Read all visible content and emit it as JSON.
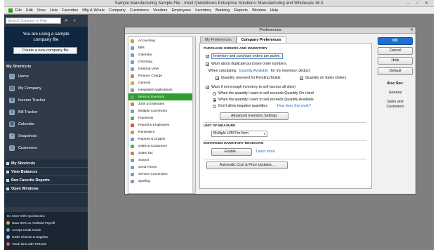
{
  "window": {
    "title": "Sample Manufacturing Sample File - Intuit QuickBooks Enterprise Solutions: Manufacturing and Wholesale 16.0",
    "controls": "– ▫ ✕"
  },
  "menu": [
    "File",
    "Edit",
    "View",
    "Lists",
    "Favorites",
    "Mfg & Whsle",
    "Company",
    "Customers",
    "Vendors",
    "Employees",
    "Inventory",
    "Banking",
    "Reports",
    "Window",
    "Help"
  ],
  "leftnav": {
    "search_placeholder": "Search Company or Help",
    "search_glyph": "⌕",
    "collapse_glyph": "‹",
    "promo_line1": "You are using a sample",
    "promo_line2": "company file",
    "create_button": "Create a new company file",
    "shortcuts_heading": "My Shortcuts",
    "shortcuts": [
      {
        "label": "Home",
        "icon": "home-icon",
        "glyph": "⌂"
      },
      {
        "label": "My Company",
        "icon": "company-icon",
        "glyph": "▤"
      },
      {
        "label": "Income Tracker",
        "icon": "income-tracker-icon",
        "glyph": "$"
      },
      {
        "label": "Bill Tracker",
        "icon": "bill-tracker-icon",
        "glyph": "≡"
      },
      {
        "label": "Calendar",
        "icon": "calendar-icon",
        "glyph": "▦"
      },
      {
        "label": "Snapshots",
        "icon": "snapshots-icon",
        "glyph": "◔"
      },
      {
        "label": "Customers",
        "icon": "customers-icon",
        "glyph": "☺"
      }
    ],
    "bottom_items": [
      "My Shortcuts",
      "View Balances",
      "Run Favorite Reports",
      "Open Windows"
    ],
    "do_more_heading": "Do More With QuickBooks",
    "do_more": [
      {
        "label": "Save 20% on Assisted Payroll",
        "color": "#e8a33b"
      },
      {
        "label": "Accept Credit Cards",
        "color": "#6aa7e0"
      },
      {
        "label": "Order Checks & Supplies",
        "color": "#9bc3e8"
      },
      {
        "label": "Track time with TSheets",
        "color": "#e05a5a"
      }
    ]
  },
  "dialog": {
    "title": "Preferences",
    "close_glyph": "✕",
    "categories": [
      {
        "label": "Accounting",
        "color": "#d0a030"
      },
      {
        "label": "Bills",
        "color": "#7aa0c8"
      },
      {
        "label": "Calendar",
        "color": "#7aa0c8"
      },
      {
        "label": "Checking",
        "color": "#7aa0c8"
      },
      {
        "label": "Desktop View",
        "color": "#7aa0c8"
      },
      {
        "label": "Finance Charge",
        "color": "#c88a4a"
      },
      {
        "label": "General",
        "color": "#d0b030"
      },
      {
        "label": "Integrated Applications",
        "color": "#7aa0c8"
      },
      {
        "label": "Items & Inventory",
        "color": "#6aaa4a"
      },
      {
        "label": "Jobs & Estimates",
        "color": "#d08a3a"
      },
      {
        "label": "Multiple Currencies",
        "color": "#7aa0c8"
      },
      {
        "label": "Payments",
        "color": "#6aaa4a"
      },
      {
        "label": "Payroll & Employees",
        "color": "#c85a5a"
      },
      {
        "label": "Reminders",
        "color": "#d0a030"
      },
      {
        "label": "Reports & Graphs",
        "color": "#7aa0c8"
      },
      {
        "label": "Sales & Customers",
        "color": "#6aaa4a"
      },
      {
        "label": "Sales Tax",
        "color": "#c88a4a"
      },
      {
        "label": "Search",
        "color": "#7aa0c8"
      },
      {
        "label": "Send Forms",
        "color": "#7aa0c8"
      },
      {
        "label": "Service Connection",
        "color": "#7aa0c8"
      },
      {
        "label": "Spelling",
        "color": "#7aa0c8"
      }
    ],
    "selected_category_index": 8,
    "tabs": [
      "My Preferences",
      "Company Preferences"
    ],
    "active_tab_index": 1,
    "po_section": "PURCHASE ORDERS AND INVENTORY",
    "inventory_active": "Inventory and purchase orders are active.",
    "warn_duplicate_po": "Warn about duplicate purchase order numbers.",
    "when_calculating": "When calculating",
    "quantity_available": "Quantity Available",
    "for_my_inventory": "for my inventory, deduct:",
    "qty_reserved": "Quantity reserved for Pending Builds",
    "qty_sales_orders": "Quantity on Sales Orders",
    "warn_not_enough": "Warn if not enough inventory to sell (across all sites)",
    "radio_on_hand": "When the quantity I want to sell exceeds Quantity On Hand",
    "radio_available": "When the quantity I want to sell exceeds Quantity Available",
    "radio_negative": "Don't allow negative quantities",
    "how_does_this_work": "How does this work?",
    "advanced_inventory_button": "Advanced Inventory Settings",
    "uom_section": "UNIT OF MEASURE",
    "uom_value": "Multiple U/M Per Item",
    "dropdown_glyph": "▾",
    "adv_receiving_section": "ENHANCED INVENTORY RECEIVING",
    "enable_button": "Enable...",
    "learn_more": "Learn more",
    "auto_cost_button": "Automatic Cost & Price Updates...",
    "ok": "OK",
    "cancel": "Cancel",
    "help": "Help",
    "default": "Default",
    "also_see": "Also See:",
    "also_general": "General",
    "also_sales1": "Sales and",
    "also_sales2": "Customers",
    "check_glyph": "✓"
  }
}
